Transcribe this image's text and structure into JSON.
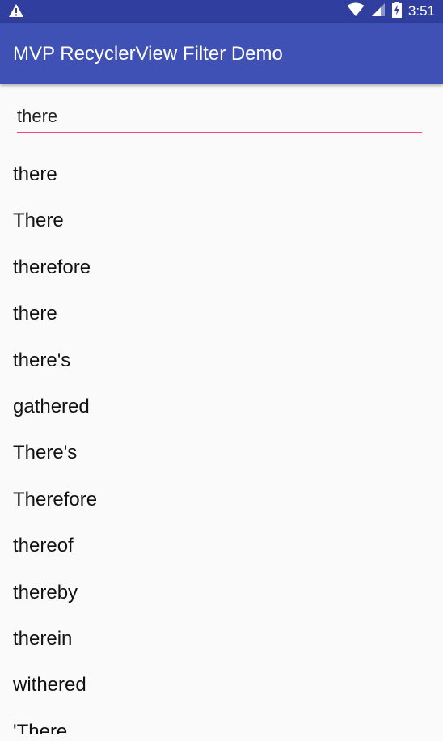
{
  "status_bar": {
    "time": "3:51",
    "icons": [
      "warning-icon",
      "wifi-icon",
      "signal-icon",
      "battery-icon"
    ]
  },
  "app_bar": {
    "title": "MVP RecyclerView Filter Demo"
  },
  "search": {
    "value": "there"
  },
  "words": [
    "there",
    "There",
    "therefore",
    "there",
    "there's",
    "gathered",
    "There's",
    "Therefore",
    "thereof",
    "thereby",
    "therein",
    "withered",
    "'There"
  ],
  "colors": {
    "primary": "#3f51b5",
    "primary_dark": "#303f9f",
    "accent": "#ff4081",
    "background": "#fafafa"
  }
}
